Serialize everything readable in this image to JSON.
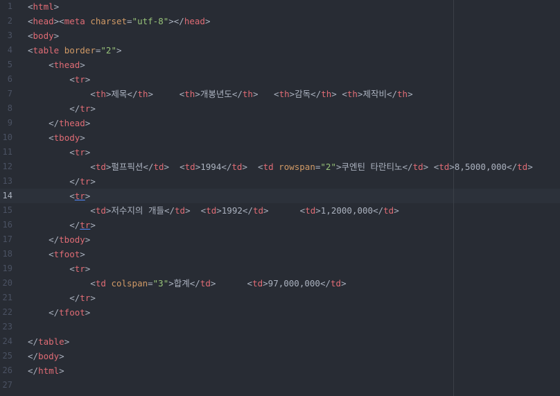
{
  "editor": {
    "line_numbers": [
      "1",
      "2",
      "3",
      "4",
      "5",
      "6",
      "7",
      "8",
      "9",
      "10",
      "11",
      "12",
      "13",
      "14",
      "15",
      "16",
      "17",
      "18",
      "19",
      "20",
      "21",
      "22",
      "23",
      "24",
      "25",
      "26",
      "27"
    ],
    "active_line": "14",
    "lines": [
      [
        {
          "t": "p",
          "v": "<"
        },
        {
          "t": "t",
          "v": "html"
        },
        {
          "t": "p",
          "v": ">"
        }
      ],
      [
        {
          "t": "p",
          "v": "<"
        },
        {
          "t": "t",
          "v": "head"
        },
        {
          "t": "p",
          "v": "><"
        },
        {
          "t": "t",
          "v": "meta"
        },
        {
          "t": "p",
          "v": " "
        },
        {
          "t": "a",
          "v": "charset"
        },
        {
          "t": "p",
          "v": "="
        },
        {
          "t": "s",
          "v": "\"utf-8\""
        },
        {
          "t": "p",
          "v": "></"
        },
        {
          "t": "t",
          "v": "head"
        },
        {
          "t": "p",
          "v": ">"
        }
      ],
      [
        {
          "t": "p",
          "v": "<"
        },
        {
          "t": "t",
          "v": "body"
        },
        {
          "t": "p",
          "v": ">"
        }
      ],
      [
        {
          "t": "p",
          "v": "<"
        },
        {
          "t": "t",
          "v": "table"
        },
        {
          "t": "p",
          "v": " "
        },
        {
          "t": "a",
          "v": "border"
        },
        {
          "t": "p",
          "v": "="
        },
        {
          "t": "s",
          "v": "\"2\""
        },
        {
          "t": "p",
          "v": ">"
        }
      ],
      [
        {
          "t": "p",
          "v": "    <"
        },
        {
          "t": "t",
          "v": "thead"
        },
        {
          "t": "p",
          "v": ">"
        }
      ],
      [
        {
          "t": "p",
          "v": "        <"
        },
        {
          "t": "t",
          "v": "tr"
        },
        {
          "t": "p",
          "v": ">"
        }
      ],
      [
        {
          "t": "p",
          "v": "            <"
        },
        {
          "t": "t",
          "v": "th"
        },
        {
          "t": "p",
          "v": ">제목</"
        },
        {
          "t": "t",
          "v": "th"
        },
        {
          "t": "p",
          "v": ">     <"
        },
        {
          "t": "t",
          "v": "th"
        },
        {
          "t": "p",
          "v": ">개봉년도</"
        },
        {
          "t": "t",
          "v": "th"
        },
        {
          "t": "p",
          "v": ">   <"
        },
        {
          "t": "t",
          "v": "th"
        },
        {
          "t": "p",
          "v": ">감독</"
        },
        {
          "t": "t",
          "v": "th"
        },
        {
          "t": "p",
          "v": "> <"
        },
        {
          "t": "t",
          "v": "th"
        },
        {
          "t": "p",
          "v": ">제작비</"
        },
        {
          "t": "t",
          "v": "th"
        },
        {
          "t": "p",
          "v": ">"
        }
      ],
      [
        {
          "t": "p",
          "v": "        </"
        },
        {
          "t": "t",
          "v": "tr"
        },
        {
          "t": "p",
          "v": ">"
        }
      ],
      [
        {
          "t": "p",
          "v": "    </"
        },
        {
          "t": "t",
          "v": "thead"
        },
        {
          "t": "p",
          "v": ">"
        }
      ],
      [
        {
          "t": "p",
          "v": "    <"
        },
        {
          "t": "t",
          "v": "tbody"
        },
        {
          "t": "p",
          "v": ">"
        }
      ],
      [
        {
          "t": "p",
          "v": "        <"
        },
        {
          "t": "t",
          "v": "tr"
        },
        {
          "t": "p",
          "v": ">"
        }
      ],
      [
        {
          "t": "p",
          "v": "            <"
        },
        {
          "t": "t",
          "v": "td"
        },
        {
          "t": "p",
          "v": ">펄프픽션</"
        },
        {
          "t": "t",
          "v": "td"
        },
        {
          "t": "p",
          "v": ">  <"
        },
        {
          "t": "t",
          "v": "td"
        },
        {
          "t": "p",
          "v": ">1994</"
        },
        {
          "t": "t",
          "v": "td"
        },
        {
          "t": "p",
          "v": ">  <"
        },
        {
          "t": "t",
          "v": "td"
        },
        {
          "t": "p",
          "v": " "
        },
        {
          "t": "a",
          "v": "rowspan"
        },
        {
          "t": "p",
          "v": "="
        },
        {
          "t": "s",
          "v": "\"2\""
        },
        {
          "t": "p",
          "v": ">쿠엔틴 타란티노</"
        },
        {
          "t": "t",
          "v": "td"
        },
        {
          "t": "p",
          "v": "> <"
        },
        {
          "t": "t",
          "v": "td"
        },
        {
          "t": "p",
          "v": ">8,5000,000</"
        },
        {
          "t": "t",
          "v": "td"
        },
        {
          "t": "p",
          "v": ">"
        }
      ],
      [
        {
          "t": "p",
          "v": "        </"
        },
        {
          "t": "t",
          "v": "tr"
        },
        {
          "t": "p",
          "v": ">"
        }
      ],
      [
        {
          "t": "p",
          "v": "        <"
        },
        {
          "t": "tu",
          "v": "tr"
        },
        {
          "t": "p",
          "v": ">"
        }
      ],
      [
        {
          "t": "p",
          "v": "            <"
        },
        {
          "t": "t",
          "v": "td"
        },
        {
          "t": "p",
          "v": ">저수지의 개들</"
        },
        {
          "t": "t",
          "v": "td"
        },
        {
          "t": "p",
          "v": ">  <"
        },
        {
          "t": "t",
          "v": "td"
        },
        {
          "t": "p",
          "v": ">1992</"
        },
        {
          "t": "t",
          "v": "td"
        },
        {
          "t": "p",
          "v": ">      <"
        },
        {
          "t": "t",
          "v": "td"
        },
        {
          "t": "p",
          "v": ">1,2000,000</"
        },
        {
          "t": "t",
          "v": "td"
        },
        {
          "t": "p",
          "v": ">"
        }
      ],
      [
        {
          "t": "p",
          "v": "        </"
        },
        {
          "t": "tu",
          "v": "tr"
        },
        {
          "t": "p",
          "v": ">"
        }
      ],
      [
        {
          "t": "p",
          "v": "    </"
        },
        {
          "t": "t",
          "v": "tbody"
        },
        {
          "t": "p",
          "v": ">"
        }
      ],
      [
        {
          "t": "p",
          "v": "    <"
        },
        {
          "t": "t",
          "v": "tfoot"
        },
        {
          "t": "p",
          "v": ">"
        }
      ],
      [
        {
          "t": "p",
          "v": "        <"
        },
        {
          "t": "t",
          "v": "tr"
        },
        {
          "t": "p",
          "v": ">"
        }
      ],
      [
        {
          "t": "p",
          "v": "            <"
        },
        {
          "t": "t",
          "v": "td"
        },
        {
          "t": "p",
          "v": " "
        },
        {
          "t": "a",
          "v": "colspan"
        },
        {
          "t": "p",
          "v": "="
        },
        {
          "t": "s",
          "v": "\"3\""
        },
        {
          "t": "p",
          "v": ">합계</"
        },
        {
          "t": "t",
          "v": "td"
        },
        {
          "t": "p",
          "v": ">      <"
        },
        {
          "t": "t",
          "v": "td"
        },
        {
          "t": "p",
          "v": ">97,000,000</"
        },
        {
          "t": "t",
          "v": "td"
        },
        {
          "t": "p",
          "v": ">"
        }
      ],
      [
        {
          "t": "p",
          "v": "        </"
        },
        {
          "t": "t",
          "v": "tr"
        },
        {
          "t": "p",
          "v": ">"
        }
      ],
      [
        {
          "t": "p",
          "v": "    </"
        },
        {
          "t": "t",
          "v": "tfoot"
        },
        {
          "t": "p",
          "v": ">"
        }
      ],
      [],
      [
        {
          "t": "p",
          "v": "</"
        },
        {
          "t": "t",
          "v": "table"
        },
        {
          "t": "p",
          "v": ">"
        }
      ],
      [
        {
          "t": "p",
          "v": "</"
        },
        {
          "t": "t",
          "v": "body"
        },
        {
          "t": "p",
          "v": ">"
        }
      ],
      [
        {
          "t": "p",
          "v": "</"
        },
        {
          "t": "t",
          "v": "html"
        },
        {
          "t": "p",
          "v": ">"
        }
      ],
      []
    ]
  },
  "colors": {
    "background": "#282c34",
    "tag": "#e06c75",
    "attribute": "#d19a66",
    "string": "#98c379",
    "text": "#abb2bf",
    "line_number": "#4b5263"
  }
}
